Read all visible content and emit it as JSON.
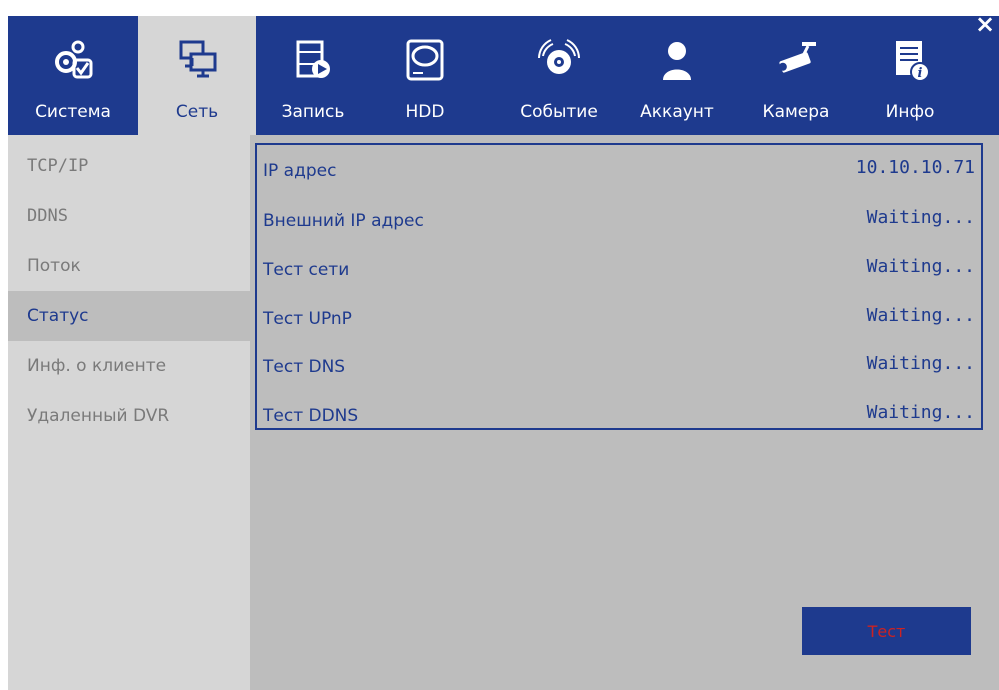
{
  "window": {
    "close_label": "×"
  },
  "tabs": [
    {
      "label": "Система",
      "icon": "gears-check-icon"
    },
    {
      "label": "Сеть",
      "icon": "network-monitors-icon"
    },
    {
      "label": "Запись",
      "icon": "film-play-icon"
    },
    {
      "label": "HDD",
      "icon": "hard-disk-icon"
    },
    {
      "label": "Событие",
      "icon": "alarm-bell-icon"
    },
    {
      "label": "Аккаунт",
      "icon": "user-icon"
    },
    {
      "label": "Камера",
      "icon": "security-camera-icon"
    },
    {
      "label": "Инфо",
      "icon": "info-document-icon"
    }
  ],
  "active_tab": "Сеть",
  "sidebar": {
    "items": [
      {
        "label": "TCP/IP"
      },
      {
        "label": "DDNS"
      },
      {
        "label": "Поток"
      },
      {
        "label": "Статус"
      },
      {
        "label": "Инф. о клиенте"
      },
      {
        "label": "Удаленный DVR"
      }
    ],
    "active": "Статус"
  },
  "status": {
    "rows": [
      {
        "label": "IP адрес",
        "value": "10.10.10.71"
      },
      {
        "label": "Внешний IP адрес",
        "value": "Waiting..."
      },
      {
        "label": "Тест сети",
        "value": "Waiting..."
      },
      {
        "label": "Тест UPnP",
        "value": "Waiting..."
      },
      {
        "label": "Тест DNS",
        "value": "Waiting..."
      },
      {
        "label": "Тест DDNS",
        "value": "Waiting..."
      }
    ]
  },
  "actions": {
    "test_label": "Тест"
  },
  "colors": {
    "primary": "#1e3a8e",
    "panel": "#d6d6d6",
    "content": "#bdbdbd",
    "muted_text": "#7a7a7a",
    "button_text": "#cc2222"
  }
}
